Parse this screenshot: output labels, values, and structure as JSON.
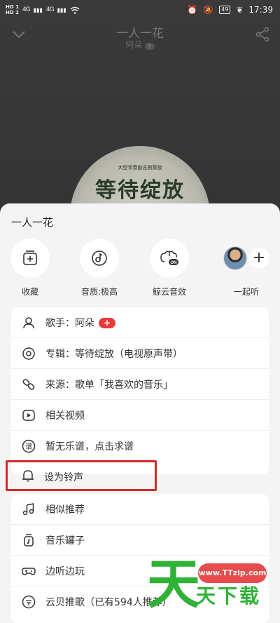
{
  "status_bar": {
    "sim1": "HD 1",
    "sim2": "HD 2",
    "signal1": "4G",
    "signal2": "4G",
    "battery": "49",
    "time": "17:39"
  },
  "player": {
    "song_title": "一人一花",
    "artist": "阿朵",
    "artist_badge": "+",
    "album_art_text": "等待绽放",
    "album_art_subtext": "大型青春励志剧集版"
  },
  "sheet": {
    "title": "一人一花",
    "quick_actions": [
      {
        "label": "收藏",
        "icon": "add-to-playlist-icon"
      },
      {
        "label": "音质:极高",
        "icon": "sound-quality-icon"
      },
      {
        "label": "鲸云音效",
        "icon": "whale-sound-effect-icon"
      },
      {
        "label": "一起听",
        "icon": "listen-together-icon"
      }
    ],
    "together_plus": "+",
    "menu_group1": [
      {
        "label": "歌手：阿朵",
        "icon": "singer-icon",
        "badge": "+"
      },
      {
        "label": "专辑：等待绽放（电视原声带）",
        "icon": "album-icon"
      },
      {
        "label": "来源：歌单「我喜欢的音乐」",
        "icon": "source-link-icon"
      },
      {
        "label": "相关视频",
        "icon": "video-icon"
      },
      {
        "label": "暂无乐谱，点击求谱",
        "icon": "sheet-music-icon"
      },
      {
        "label": "设为铃声",
        "icon": "bell-icon"
      }
    ],
    "menu_group2": [
      {
        "label": "相似推荐",
        "icon": "similar-music-icon"
      },
      {
        "label": "音乐罐子",
        "icon": "music-jar-icon"
      },
      {
        "label": "边听边玩",
        "icon": "gamepad-icon"
      },
      {
        "label": "云贝推歌（已有594人推荐）",
        "icon": "cloud-coin-icon"
      }
    ]
  },
  "watermark": {
    "url": "www.TTzip.com",
    "big": "天",
    "small": "天下载"
  },
  "colors": {
    "accent_red": "#e93a3a",
    "highlight_border": "#d42a2a",
    "watermark_green": "#2fb336"
  }
}
